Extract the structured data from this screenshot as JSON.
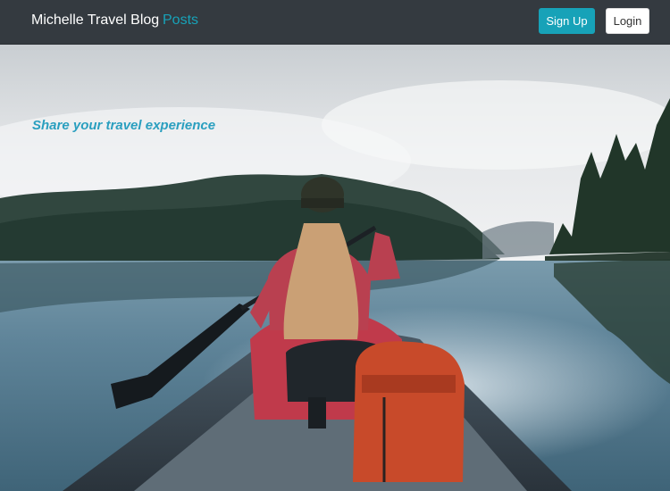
{
  "nav": {
    "brand": "Michelle Travel Blog",
    "posts_link": "Posts",
    "signup_label": "Sign Up",
    "login_label": "Login"
  },
  "hero": {
    "tagline": "Share your travel experience",
    "image_icon": "photo"
  },
  "colors": {
    "navbar_bg": "#343a40",
    "accent": "#17a2b8",
    "tagline": "#2a9fbf"
  }
}
